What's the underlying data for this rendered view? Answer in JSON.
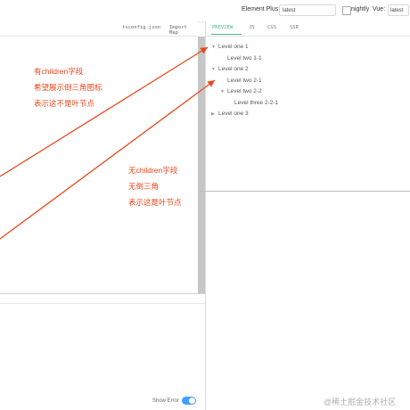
{
  "header": {
    "version_label": "Element Plus:",
    "version_value": "latest",
    "nightly_label": "nightly",
    "vue_label": "Vue:",
    "vue_value": "latest"
  },
  "editor_tabs": [
    "tsconfig.json",
    "Import Map"
  ],
  "preview_tabs": [
    "PREVIEW",
    "JS",
    "CSS",
    "SSR"
  ],
  "tree": [
    {
      "label": "Level one 1",
      "arrow": "▼"
    },
    {
      "label": "Level two 1-1",
      "arrow": ""
    },
    {
      "label": "Level one 2",
      "arrow": "▼"
    },
    {
      "label": "Level two 2-1",
      "arrow": ""
    },
    {
      "label": "Level two 2-2",
      "arrow": "▼"
    },
    {
      "label": "Level three 2-2-1",
      "arrow": ""
    },
    {
      "label": "Level one 3",
      "arrow": "▶"
    }
  ],
  "annotations": {
    "note1": [
      "有children字段",
      "希望展示倒三角图标",
      "表示这不是叶节点"
    ],
    "note2": [
      "无children字段",
      "无倒三角",
      "表示这是叶节点"
    ]
  },
  "footer": {
    "show_error_label": "Show Error"
  },
  "watermark": "@稀土掘金技术社区",
  "colors": {
    "accent": "#409eff",
    "annotation": "#e8481c",
    "preview_active": "#42b883"
  }
}
